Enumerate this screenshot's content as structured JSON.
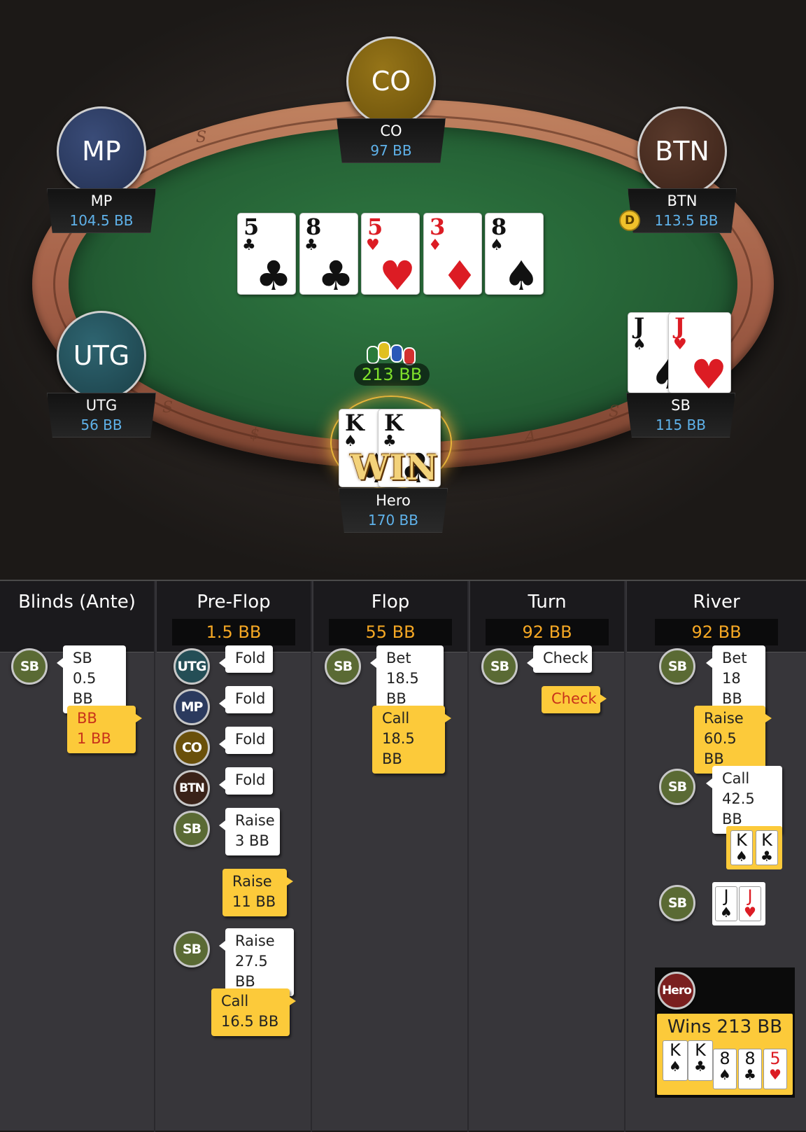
{
  "table": {
    "rail_letters": [
      "S",
      "U",
      "$",
      "$",
      "A",
      "S"
    ],
    "board": [
      {
        "rank": "5",
        "suit": "♣",
        "color": "black"
      },
      {
        "rank": "8",
        "suit": "♣",
        "color": "black"
      },
      {
        "rank": "5",
        "suit": "♥",
        "color": "red"
      },
      {
        "rank": "3",
        "suit": "♦",
        "color": "red"
      },
      {
        "rank": "8",
        "suit": "♠",
        "color": "black"
      }
    ],
    "pot": "213 BB",
    "win_label": "WIN",
    "dealer": "D"
  },
  "players": {
    "co": {
      "avatar": "CO",
      "name": "CO",
      "stack": "97 BB",
      "color": "#7a5c0c"
    },
    "mp": {
      "avatar": "MP",
      "name": "MP",
      "stack": "104.5 BB",
      "color": "#2b3a5e"
    },
    "btn": {
      "avatar": "BTN",
      "name": "BTN",
      "stack": "113.5 BB",
      "color": "#4a2e22"
    },
    "utg": {
      "avatar": "UTG",
      "name": "UTG",
      "stack": "56 BB",
      "color": "#244e56"
    },
    "sb": {
      "name": "SB",
      "stack": "115 BB",
      "cards": [
        {
          "rank": "J",
          "suit": "♠",
          "color": "black"
        },
        {
          "rank": "J",
          "suit": "♥",
          "color": "red"
        }
      ]
    },
    "hero": {
      "name": "Hero",
      "stack": "170 BB",
      "cards": [
        {
          "rank": "K",
          "suit": "♠",
          "color": "black"
        },
        {
          "rank": "K",
          "suit": "♣",
          "color": "black"
        }
      ]
    }
  },
  "history": {
    "blinds": {
      "title": "Blinds (Ante)",
      "sb_icon": "SB",
      "sb_action": "SB",
      "sb_amount": "0.5 BB",
      "bb_action": "BB",
      "bb_amount": "1 BB"
    },
    "preflop": {
      "title": "Pre-Flop",
      "pot": "1.5 BB",
      "a1_icon": "UTG",
      "a1": "Fold",
      "a2_icon": "MP",
      "a2": "Fold",
      "a3_icon": "CO",
      "a3": "Fold",
      "a4_icon": "BTN",
      "a4": "Fold",
      "a5_icon": "SB",
      "a5": "Raise",
      "a5_amt": "3 BB",
      "a6": "Raise",
      "a6_amt": "11 BB",
      "a7_icon": "SB",
      "a7": "Raise",
      "a7_amt": "27.5 BB",
      "a8": "Call",
      "a8_amt": "16.5 BB"
    },
    "flop": {
      "title": "Flop",
      "pot": "55 BB",
      "a1_icon": "SB",
      "a1": "Bet",
      "a1_amt": "18.5 BB",
      "a2": "Call",
      "a2_amt": "18.5 BB"
    },
    "turn": {
      "title": "Turn",
      "pot": "92 BB",
      "a1_icon": "SB",
      "a1": "Check",
      "a2": "Check"
    },
    "river": {
      "title": "River",
      "pot": "92 BB",
      "a1_icon": "SB",
      "a1": "Bet",
      "a1_amt": "18 BB",
      "a2": "Raise",
      "a2_amt": "60.5 BB",
      "a3_icon": "SB",
      "a3": "Call",
      "a3_amt": "42.5 BB",
      "sd_icon": "SB",
      "hero_icon": "Hero",
      "wins": "Wins 213 BB",
      "hero_cards": [
        {
          "rank": "K",
          "suit": "♠"
        },
        {
          "rank": "K",
          "suit": "♣"
        }
      ],
      "sb_cards": [
        {
          "rank": "J",
          "suit": "♠"
        },
        {
          "rank": "J",
          "suit": "♥"
        }
      ],
      "best_hand": [
        {
          "rank": "K",
          "suit": "♠"
        },
        {
          "rank": "K",
          "suit": "♣"
        },
        {
          "rank": "8",
          "suit": "♠"
        },
        {
          "rank": "8",
          "suit": "♣"
        },
        {
          "rank": "5",
          "suit": "♥"
        }
      ]
    }
  }
}
